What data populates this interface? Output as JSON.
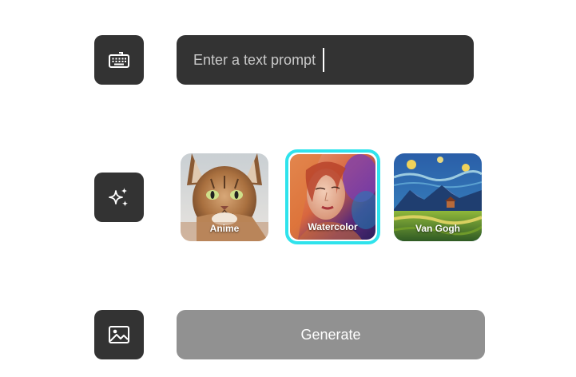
{
  "prompt": {
    "placeholder": "Enter a text prompt"
  },
  "icons": {
    "text_input": "keyboard-icon",
    "style": "sparkle-icon",
    "output": "image-icon"
  },
  "styles": [
    {
      "label": "Anime",
      "selected": false
    },
    {
      "label": "Watercolor",
      "selected": true
    },
    {
      "label": "Van Gogh",
      "selected": false
    }
  ],
  "generate": {
    "label": "Generate"
  },
  "colors": {
    "tile": "#333333",
    "selection_border": "#2fe3ec",
    "generate_disabled": "#919191"
  }
}
